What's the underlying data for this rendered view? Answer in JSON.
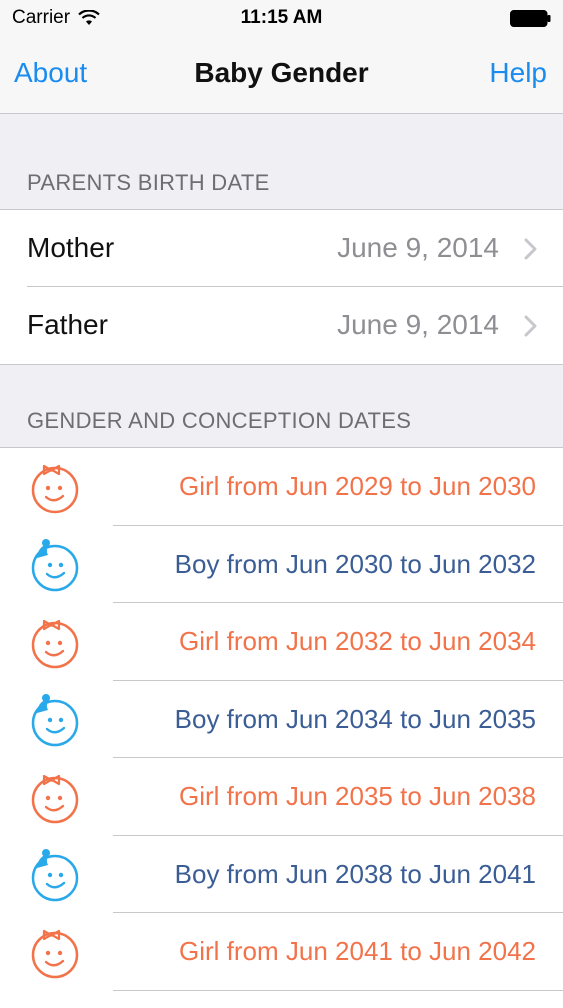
{
  "status_bar": {
    "carrier": "Carrier",
    "time": "11:15 AM"
  },
  "nav": {
    "left_button": "About",
    "title": "Baby Gender",
    "right_button": "Help"
  },
  "parents": {
    "header": "PARENTS BIRTH DATE",
    "rows": [
      {
        "label": "Mother",
        "value": "June 9, 2014"
      },
      {
        "label": "Father",
        "value": "June 9, 2014"
      }
    ]
  },
  "gender": {
    "header": "GENDER AND CONCEPTION DATES",
    "rows": [
      {
        "gender": "girl",
        "icon": "girl-face-icon",
        "text": "Girl from Jun 2029 to Jun 2030"
      },
      {
        "gender": "boy",
        "icon": "boy-face-icon",
        "text": "Boy from Jun 2030 to Jun 2032"
      },
      {
        "gender": "girl",
        "icon": "girl-face-icon",
        "text": "Girl from Jun 2032 to Jun 2034"
      },
      {
        "gender": "boy",
        "icon": "boy-face-icon",
        "text": "Boy from Jun 2034 to Jun 2035"
      },
      {
        "gender": "girl",
        "icon": "girl-face-icon",
        "text": "Girl from Jun 2035 to Jun 2038"
      },
      {
        "gender": "boy",
        "icon": "boy-face-icon",
        "text": "Boy from Jun 2038 to Jun 2041"
      },
      {
        "gender": "girl",
        "icon": "girl-face-icon",
        "text": "Girl from Jun 2041 to Jun 2042"
      }
    ]
  },
  "colors": {
    "accent": "#1a8cf0",
    "girl": "#f2734a",
    "boy": "#3a5d95",
    "boy_icon": "#29a8ea"
  }
}
